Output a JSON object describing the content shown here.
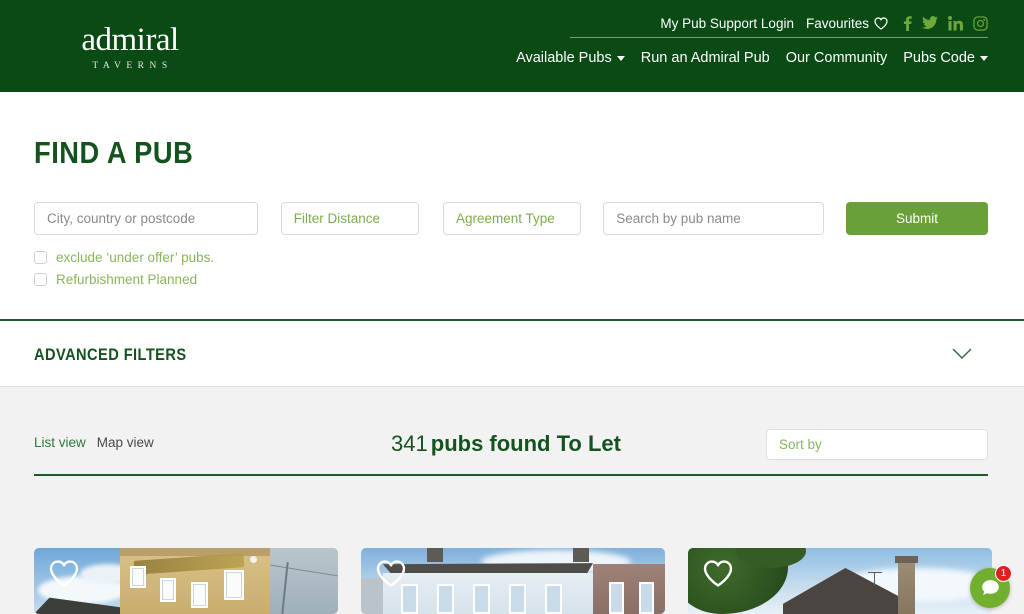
{
  "site": {
    "logo_main": "admiral",
    "logo_sub": "TAVERNS"
  },
  "header": {
    "top_links": [
      {
        "label": "My Pub Support Login",
        "name": "my-pub-support-login"
      },
      {
        "label": "Favourites",
        "name": "favourites"
      }
    ],
    "social": [
      "facebook-icon",
      "twitter-icon",
      "linkedin-icon",
      "instagram-icon"
    ],
    "nav": [
      {
        "label": "Available Pubs",
        "caret": true
      },
      {
        "label": "Run an Admiral Pub",
        "caret": false
      },
      {
        "label": "Our Community",
        "caret": false
      },
      {
        "label": "Pubs Code",
        "caret": true
      }
    ]
  },
  "find": {
    "title": "FIND A PUB",
    "fields": {
      "location_placeholder": "City, country or postcode",
      "distance_placeholder": "Filter Distance",
      "agreement_placeholder": "Agreement Type",
      "pubname_placeholder": "Search by pub name"
    },
    "submit_label": "Submit",
    "checkboxes": [
      {
        "label": "exclude ‘under offer’ pubs.",
        "checked": false
      },
      {
        "label": "Refurbishment Planned",
        "checked": false
      }
    ]
  },
  "advanced_filters": {
    "title": "ADVANCED FILTERS",
    "expanded": false
  },
  "results": {
    "view_links": [
      {
        "label": "List view",
        "active": true
      },
      {
        "label": "Map view",
        "active": false
      }
    ],
    "count": "341",
    "count_text": "pubs found To Let",
    "sort_placeholder": "Sort by",
    "cards": [
      {
        "name": "pub-card-1",
        "favourited": false
      },
      {
        "name": "pub-card-2",
        "favourited": false
      },
      {
        "name": "pub-card-3",
        "favourited": false
      }
    ]
  },
  "chat_widget": {
    "badge": "1"
  },
  "colors": {
    "header_green": "#0a4a15",
    "accent_green": "#6aa03a",
    "light_green": "#86b75b",
    "dark_green": "#14521f",
    "results_bg": "#f2f2f2",
    "badge_red": "#e02020"
  }
}
